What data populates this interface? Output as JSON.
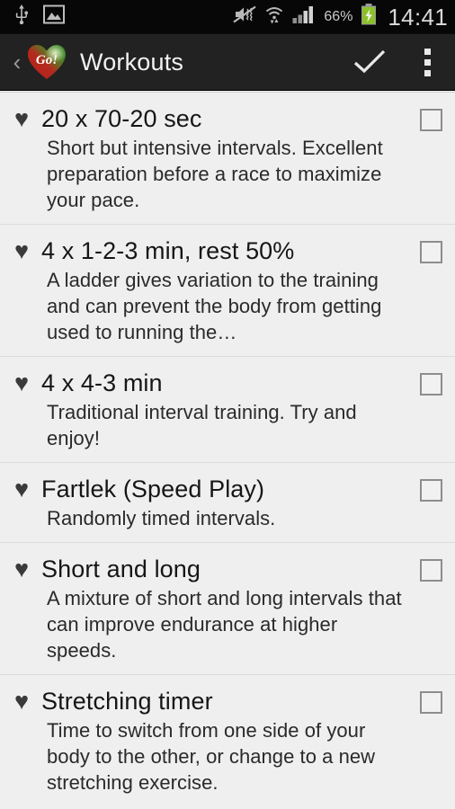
{
  "status_bar": {
    "icons": [
      "usb-icon",
      "screenshot-image-icon"
    ],
    "right_icons": [
      "vibrate-off-icon",
      "wifi-icon",
      "signal-bars-icon"
    ],
    "battery_percent": "66%",
    "battery_state": "charging",
    "clock": "14:41"
  },
  "action_bar": {
    "back_glyph": "‹",
    "logo": "heart-go-logo",
    "logo_text": "Go!",
    "title": "Workouts",
    "confirm_label": "✓",
    "overflow_label": "more-options"
  },
  "colors": {
    "status_bar_bg": "#070707",
    "action_bar_bg": "#222222",
    "list_bg": "#efefef",
    "divider": "#dcdcdc",
    "title_text": "#161616",
    "desc_text": "#2a2a2a",
    "heart_bullet": "#3a3a3a",
    "checkbox_border": "#8d8d8d",
    "battery_green": "#8bc224",
    "logo_red": "#c4261d",
    "logo_green": "#3f8a2a"
  },
  "workouts": [
    {
      "bullet": "♥",
      "title": "20 x 70-20 sec",
      "description": "Short but intensive intervals. Excellent preparation before a race to maximize your pace.",
      "checked": false
    },
    {
      "bullet": "♥",
      "title": "4 x 1-2-3 min, rest 50%",
      "description": "A ladder gives variation to the training and can prevent the body from getting used to running the…",
      "checked": false
    },
    {
      "bullet": "♥",
      "title": "4 x 4-3 min",
      "description": "Traditional interval training. Try and enjoy!",
      "checked": false
    },
    {
      "bullet": "♥",
      "title": "Fartlek (Speed Play)",
      "description": "Randomly timed intervals.",
      "checked": false
    },
    {
      "bullet": "♥",
      "title": "Short and long",
      "description": "A mixture of short and long intervals that can improve endurance at higher speeds.",
      "checked": false
    },
    {
      "bullet": "♥",
      "title": "Stretching timer",
      "description": "Time to switch from one side of your body to the other, or change to a new stretching exercise.",
      "checked": false
    }
  ]
}
